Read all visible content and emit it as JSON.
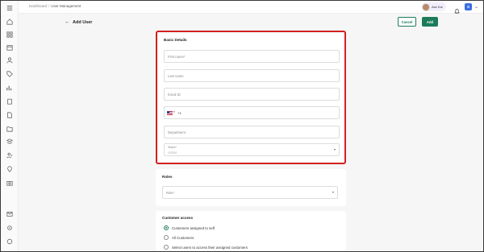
{
  "topbar": {
    "breadcrumb": [
      "Dashboard",
      "User Management"
    ],
    "user_name": "Ask Kai",
    "org_initial": "S"
  },
  "sidebar": {
    "icons": [
      "menu-icon",
      "home-icon",
      "grid-icon",
      "calendar-icon",
      "person-icon",
      "tag-icon",
      "chart-icon",
      "clipboard-icon",
      "file-icon",
      "folder-icon",
      "layers-icon",
      "users-icon",
      "pin-icon",
      "camera-icon",
      "mail-icon",
      "settings-icon",
      "help-icon"
    ]
  },
  "page": {
    "title": "Add User",
    "cancel_label": "Cancel",
    "add_label": "Add"
  },
  "basic_details": {
    "title": "Basic Details",
    "first_name_placeholder": "First name*",
    "last_name_placeholder": "Last name",
    "email_placeholder": "Email ID",
    "phone_dial_code": "+1",
    "department_placeholder": "Department",
    "status_label": "Status*",
    "status_value": "Active"
  },
  "roles": {
    "title": "Roles",
    "role_placeholder": "Role*"
  },
  "customer_access": {
    "title": "Customer access",
    "options": [
      {
        "label": "Customers assigned to self",
        "selected": true
      },
      {
        "label": "All Customers",
        "selected": false
      },
      {
        "label": "Select users to access their assigned customers",
        "selected": false
      }
    ]
  },
  "colors": {
    "primary": "#1c7c5a",
    "highlight_border": "#d21f1f",
    "org_badge": "#3b6fe0"
  }
}
